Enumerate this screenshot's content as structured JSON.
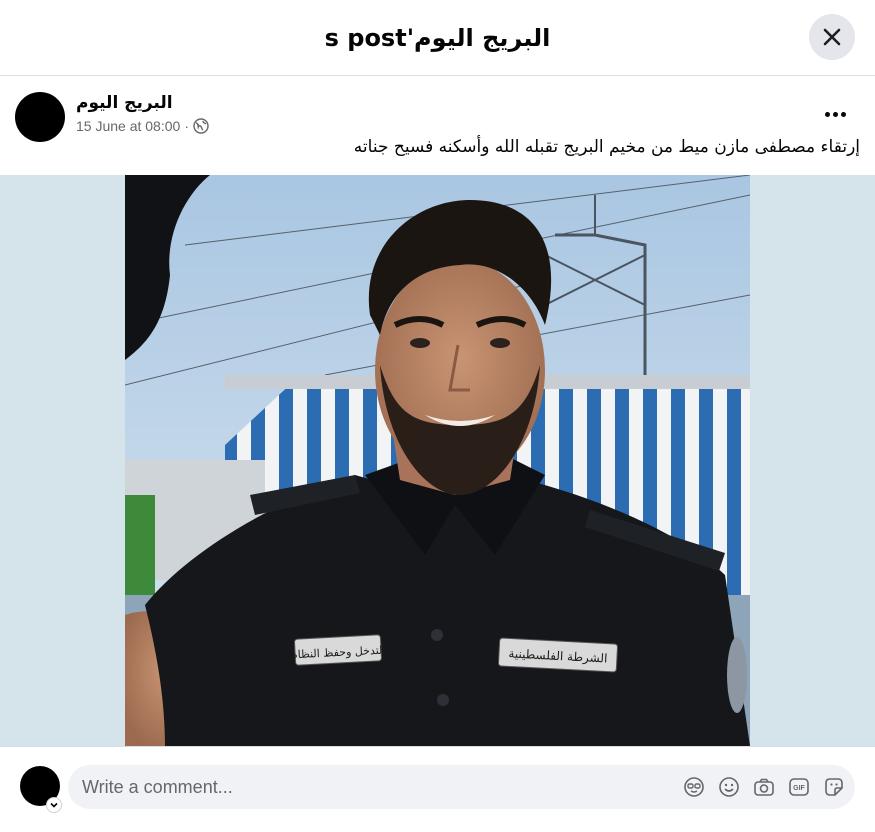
{
  "header": {
    "title": "البريج اليوم's post"
  },
  "post": {
    "author": "البريج اليوم",
    "timestamp": "15 June at 08:00",
    "separator": "·",
    "privacy_icon": "globe-icon",
    "caption": "إرتقاء  مصطفى مازن ميط من مخيم البريج تقبله الله وأسكنه فسيح جناته",
    "more_icon": "more-options-icon",
    "photo": {
      "badge_left": "التدخل وحفظ النظام",
      "badge_right": "الشرطة الفلسطينية"
    }
  },
  "comment": {
    "placeholder": "Write a comment...",
    "tools": [
      "avatar-sticker-icon",
      "emoji-icon",
      "camera-icon",
      "gif-icon",
      "sticker-icon"
    ],
    "gif_label": "GIF"
  },
  "colors": {
    "divider": "#dadde1",
    "secondary_text": "#65676b",
    "input_bg": "#f0f2f5",
    "close_bg": "#e4e6eb",
    "photo_backdrop": "#d5e3eb"
  }
}
